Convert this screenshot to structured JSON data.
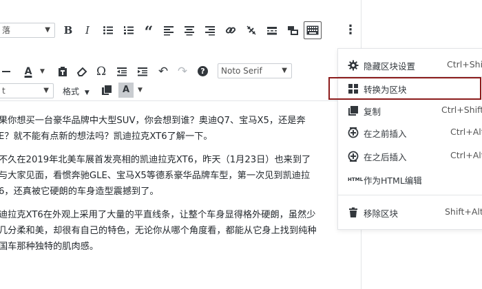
{
  "toolbar": {
    "format_select": "落",
    "font_size_select": "t",
    "font_family_select": "Noto Serif",
    "format_label": "格式",
    "more_options_label": "⋮"
  },
  "content": {
    "paragraphs": [
      [
        "果你想买一台豪华品牌中大型SUV，你会想到谁？奥迪Q7、宝马X5，还是奔",
        "E？就不能有点新的想法吗？凯迪拉克XT6了解一下。"
      ],
      [
        "不久在2019年北美车展首发亮相的凯迪拉克XT6，昨天（1月23日）也来到了",
        "与大家见面，看惯奔驰GLE、宝马X5等德系豪华品牌车型，第一次见到凯迪拉",
        "6，还真被它硬朗的车身造型震撼到了。"
      ],
      [
        "迪拉克XT6在外观上采用了大量的平直线条，让整个车身显得格外硬朗，虽然少",
        "几分柔和美，却很有自己的特色，无论你从哪个角度看，都能从它身上找到纯种",
        "国车那种独特的肌肉感。"
      ]
    ]
  },
  "menu": {
    "items": [
      {
        "label": "隐藏区块设置",
        "shortcut": "Ctrl+Shift+,",
        "icon": "gear-icon"
      },
      {
        "label": "转换为区块",
        "shortcut": "",
        "icon": "blocks-grid-icon"
      },
      {
        "label": "复制",
        "shortcut": "Ctrl+Shift+D",
        "icon": "duplicate-icon"
      },
      {
        "label": "在之前插入",
        "shortcut": "Ctrl+Alt+T",
        "icon": "insert-before-icon"
      },
      {
        "label": "在之后插入",
        "shortcut": "Ctrl+Alt+Y",
        "icon": "insert-after-icon"
      },
      {
        "label": "作为HTML编辑",
        "shortcut": "",
        "icon": "html-icon"
      },
      {
        "label": "移除区块",
        "shortcut": "Shift+Alt+Z",
        "icon": "trash-icon"
      }
    ],
    "highlight_color": "#8b1a1a"
  }
}
